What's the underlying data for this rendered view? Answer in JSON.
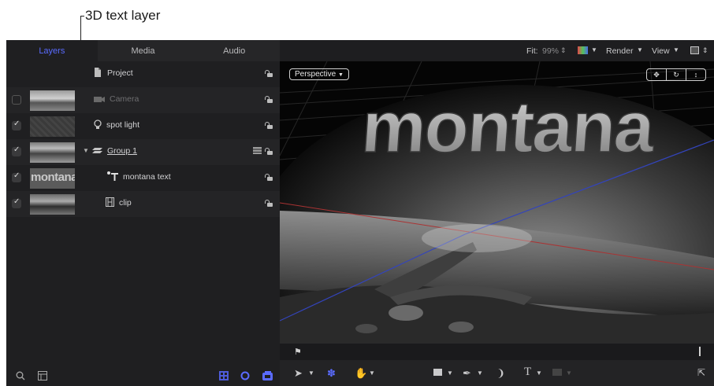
{
  "callouts": {
    "top": "3D text layer"
  },
  "tabs": [
    "Layers",
    "Media",
    "Audio"
  ],
  "layers": [
    {
      "name": "Project",
      "icon": "document-icon"
    },
    {
      "name": "Camera",
      "icon": "camera-icon",
      "disabled": true
    },
    {
      "name": "spot light",
      "icon": "light-icon"
    },
    {
      "name": "Group 1",
      "icon": "group-icon"
    },
    {
      "name": "montana text",
      "icon": "text-layer-icon",
      "thumb_text": "montana"
    },
    {
      "name": "clip",
      "icon": "film-icon"
    }
  ],
  "toolbar": {
    "fit_label": "Fit:",
    "fit_value": "99%",
    "render": "Render",
    "view": "View"
  },
  "viewport": {
    "camera_menu": "Perspective",
    "scene_text": "montana"
  },
  "colors": {
    "accent": "#5a6bff",
    "panel": "#1f1f21",
    "canvas": "#000000"
  }
}
